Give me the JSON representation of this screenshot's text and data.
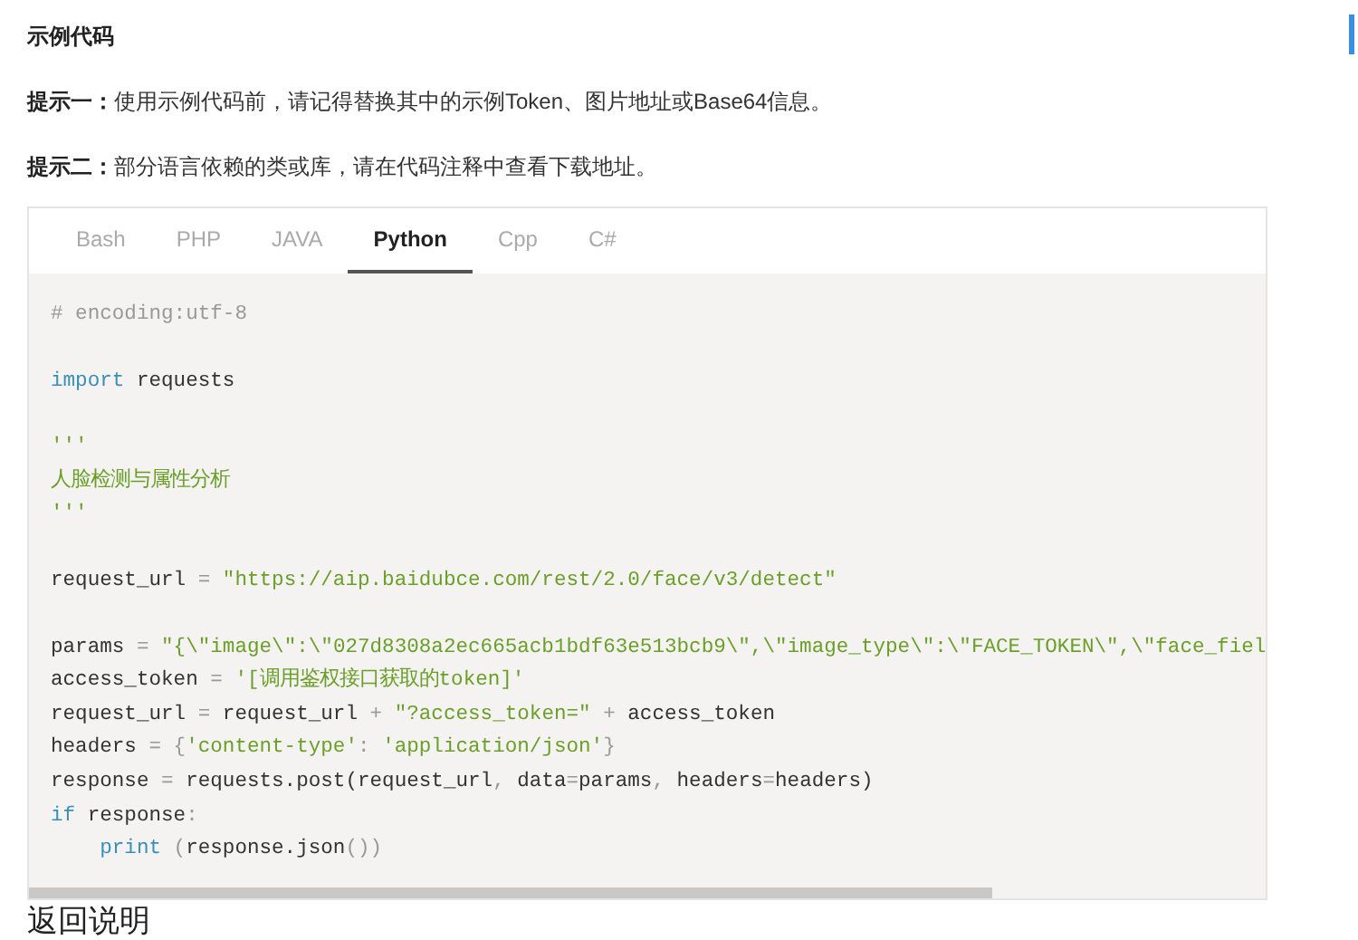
{
  "section_title": "示例代码",
  "hints": [
    {
      "label": "提示一：",
      "text": "使用示例代码前，请记得替换其中的示例Token、图片地址或Base64信息。"
    },
    {
      "label": "提示二：",
      "text": "部分语言依赖的类或库，请在代码注释中查看下载地址。"
    }
  ],
  "tabs": [
    {
      "label": "Bash",
      "selected": false
    },
    {
      "label": "PHP",
      "selected": false
    },
    {
      "label": "JAVA",
      "selected": false
    },
    {
      "label": "Python",
      "selected": true
    },
    {
      "label": "Cpp",
      "selected": false
    },
    {
      "label": "C#",
      "selected": false
    }
  ],
  "code_blocks": [
    [
      [
        {
          "kind": "comment",
          "text": "# encoding:utf-8"
        }
      ]
    ],
    [
      [
        {
          "kind": "keyword",
          "text": "import"
        },
        {
          "kind": "plain",
          "text": " requests"
        }
      ]
    ],
    [
      [
        {
          "kind": "string",
          "text": "'''"
        }
      ],
      [
        {
          "kind": "string",
          "text": "人脸检测与属性分析"
        }
      ],
      [
        {
          "kind": "string",
          "text": "'''"
        }
      ]
    ],
    [
      [
        {
          "kind": "plain",
          "text": "request_url "
        },
        {
          "kind": "punct",
          "text": "="
        },
        {
          "kind": "string",
          "text": " \"https://aip.baidubce.com/rest/2.0/face/v3/detect\""
        }
      ]
    ],
    [
      [
        {
          "kind": "plain",
          "text": "params "
        },
        {
          "kind": "punct",
          "text": "="
        },
        {
          "kind": "string",
          "text": " \"{\\\"image\\\":\\\"027d8308a2ec665acb1bdf63e513bcb9\\\",\\\"image_type\\\":\\\"FACE_TOKEN\\\",\\\"face_fiel"
        }
      ],
      [
        {
          "kind": "plain",
          "text": "access_token "
        },
        {
          "kind": "punct",
          "text": "="
        },
        {
          "kind": "string",
          "text": " '[调用鉴权接口获取的token]'"
        }
      ],
      [
        {
          "kind": "plain",
          "text": "request_url "
        },
        {
          "kind": "punct",
          "text": "="
        },
        {
          "kind": "plain",
          "text": " request_url "
        },
        {
          "kind": "punct",
          "text": "+"
        },
        {
          "kind": "string",
          "text": " \"?access_token=\" "
        },
        {
          "kind": "punct",
          "text": "+"
        },
        {
          "kind": "plain",
          "text": " access_token"
        }
      ],
      [
        {
          "kind": "plain",
          "text": "headers "
        },
        {
          "kind": "punct",
          "text": "= {"
        },
        {
          "kind": "string",
          "text": "'content-type'"
        },
        {
          "kind": "punct",
          "text": ": "
        },
        {
          "kind": "string",
          "text": "'application/json'"
        },
        {
          "kind": "punct",
          "text": "}"
        }
      ],
      [
        {
          "kind": "plain",
          "text": "response "
        },
        {
          "kind": "punct",
          "text": "="
        },
        {
          "kind": "plain",
          "text": " requests.post(request_url"
        },
        {
          "kind": "punct",
          "text": ", "
        },
        {
          "kind": "plain",
          "text": "data"
        },
        {
          "kind": "punct",
          "text": "="
        },
        {
          "kind": "plain",
          "text": "params"
        },
        {
          "kind": "punct",
          "text": ", "
        },
        {
          "kind": "plain",
          "text": "headers"
        },
        {
          "kind": "punct",
          "text": "="
        },
        {
          "kind": "plain",
          "text": "headers)"
        }
      ],
      [
        {
          "kind": "keyword",
          "text": "if"
        },
        {
          "kind": "plain",
          "text": " response"
        },
        {
          "kind": "punct",
          "text": ":"
        }
      ],
      [
        {
          "kind": "indent"
        },
        {
          "kind": "keyword",
          "text": "print"
        },
        {
          "kind": "punct",
          "text": " ("
        },
        {
          "kind": "plain",
          "text": "response.json"
        },
        {
          "kind": "punct",
          "text": "())"
        }
      ]
    ]
  ],
  "next_section_title": "返回说明"
}
